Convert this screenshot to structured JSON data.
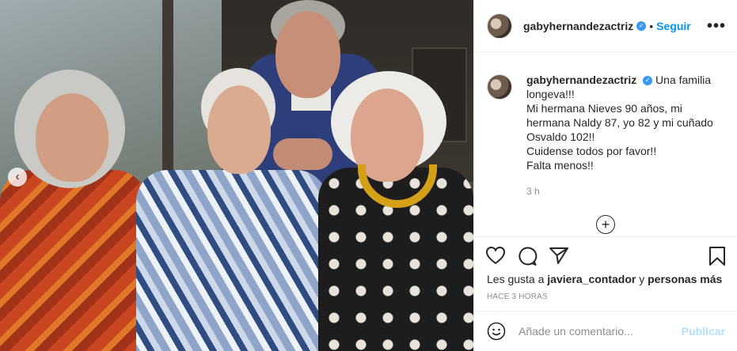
{
  "post": {
    "username": "gabyhernandezactriz",
    "follow_label": "Seguir",
    "dot": "•",
    "more_label": "•••",
    "caption_text": "Una familia longeva!!!\nMi hermana Nieves 90 años, mi hermana Naldy 87, yo 82 y mi cuñado Osvaldo 102!!\nCuidense todos por favor!!\nFalta menos!!",
    "caption_time": "3 h",
    "likes_prefix": "Les gusta a",
    "likes_user": "javiera_contador",
    "likes_and": "y",
    "likes_others": "personas más",
    "time_ago": "HACE 3 HORAS",
    "comment_placeholder": "Añade un comentario...",
    "publish_label": "Publicar",
    "verified_glyph": "✓",
    "prev_glyph": "‹",
    "add_glyph": "+"
  },
  "icons": {
    "header_avatar": "avatar",
    "verified": "verified-badge-icon",
    "like": "heart-icon",
    "comment": "comment-icon",
    "share": "share-icon",
    "save": "bookmark-icon",
    "emoji": "emoji-icon",
    "add": "plus-circle-icon",
    "prev": "chevron-left-icon"
  },
  "colors": {
    "link_blue": "#0095f6",
    "verified_blue": "#3897f0",
    "publish_disabled": "#b2dffc",
    "muted": "#8e8e8e",
    "text": "#262626"
  }
}
